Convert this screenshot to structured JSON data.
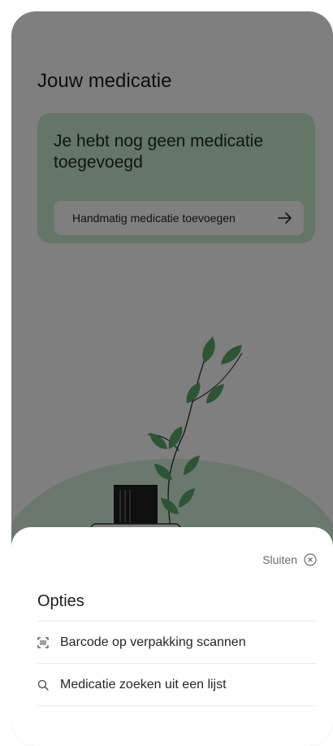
{
  "screen": {
    "title": "Jouw medicatie",
    "empty_card": {
      "message": "Je hebt nog geen medicatie toegevoegd",
      "add_button_label": "Handmatig medicatie toevoegen",
      "add_button_icon": "arrow-right-icon"
    },
    "illustration": "plant-in-pot"
  },
  "sheet": {
    "close_label": "Sluiten",
    "close_icon": "close-circle-icon",
    "title": "Opties",
    "options": [
      {
        "label": "Barcode op verpakking scannen",
        "icon": "barcode-scan-icon"
      },
      {
        "label": "Medicatie zoeken uit een lijst",
        "icon": "search-icon"
      }
    ]
  },
  "colors": {
    "card_background": "#c9ecd0",
    "overlay": "rgba(0,0,0,0.5)",
    "leaf": "#5aa86a"
  }
}
